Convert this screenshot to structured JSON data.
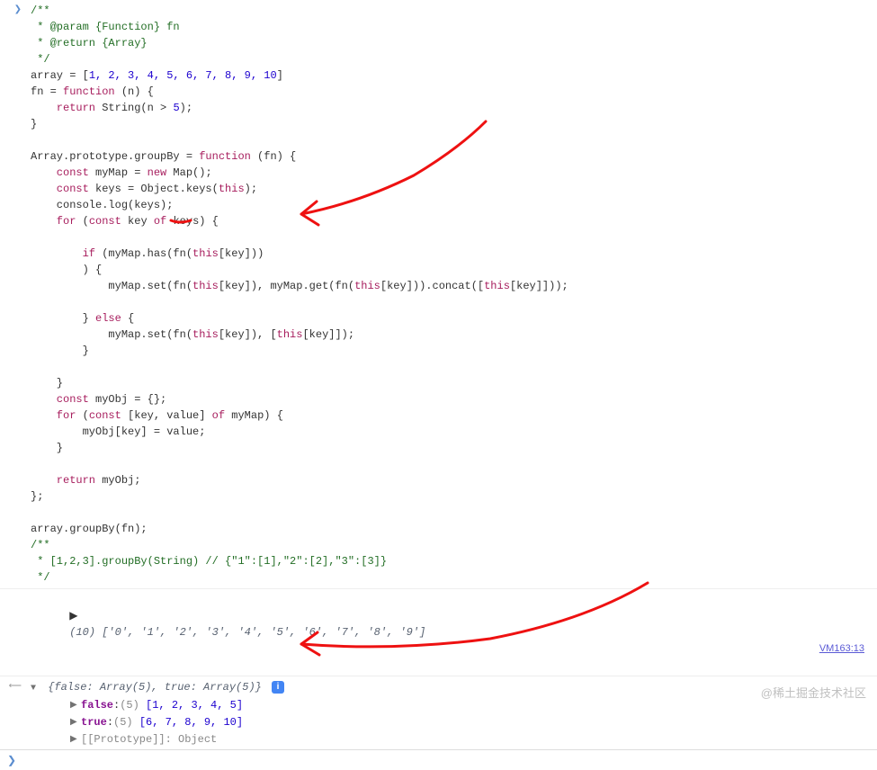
{
  "code": {
    "c1": "/**",
    "c2": " * @param {Function} fn",
    "c3": " * @return {Array}",
    "c4": " */",
    "c5_pre": "array = [",
    "c5_nums": "1, 2, 3, 4, 5, 6, 7, 8, 9, 10",
    "c5_post": "]",
    "c6": "fn = ",
    "c6_fn": "function",
    "c6_post": " (n) {",
    "c7_ret": "    return",
    "c7_post": " String(n > ",
    "c7_num": "5",
    "c7_end": ");",
    "c8": "}",
    "blank": "",
    "c9": "Array.prototype.groupBy = ",
    "c9_fn": "function",
    "c9_post": " (fn) {",
    "c10_const": "    const",
    "c10_post": " myMap = ",
    "c10_new": "new",
    "c10_end": " Map();",
    "c11_const": "    const",
    "c11_post": " keys = Object.keys(",
    "c11_this": "this",
    "c11_end": ");",
    "c12": "    console.log(keys);",
    "c13_for": "    for",
    "c13_post": " (",
    "c13_const": "const",
    "c13_key": " key ",
    "c13_of": "of",
    "c13_end": " keys) {",
    "c14_if": "        if",
    "c14_post": " (myMap.has(fn(",
    "c14_this": "this",
    "c14_end": "[key]))",
    "c15": "        ) {",
    "c16_1": "            myMap.set(fn(",
    "c16_this1": "this",
    "c16_2": "[key]), myMap.get(fn(",
    "c16_this2": "this",
    "c16_3": "[key])).concat([",
    "c16_this3": "this",
    "c16_4": "[key]]));",
    "c17": "        } ",
    "c17_else": "else",
    "c17_post": " {",
    "c18_1": "            myMap.set(fn(",
    "c18_this1": "this",
    "c18_2": "[key]), [",
    "c18_this2": "this",
    "c18_3": "[key]]);",
    "c19": "        }",
    "c20": "    }",
    "c21_const": "    const",
    "c21_post": " myObj = {};",
    "c22_for": "    for",
    "c22_post": " (",
    "c22_const": "const",
    "c22_mid": " [key, value] ",
    "c22_of": "of",
    "c22_end": " myMap) {",
    "c23": "        myObj[key] = value;",
    "c24": "    }",
    "c25_ret": "    return",
    "c25_post": " myObj;",
    "c26": "};",
    "c27": "array.groupBy(fn);",
    "c28": "/**",
    "c29": " * [1,2,3].groupBy(String) // {\"1\":[1],\"2\":[2],\"3\":[3]}",
    "c30": " */"
  },
  "output": {
    "log_preview": "(10) ['0', '1', '2', '3', '4', '5', '6', '7', '8', '9']",
    "source_link": "VM163:13",
    "result_header": "{false: Array(5), true: Array(5)}",
    "false_key": "false",
    "false_len": "(5)",
    "false_arr": "[1, 2, 3, 4, 5]",
    "true_key": "true",
    "true_len": "(5)",
    "true_arr": "[6, 7, 8, 9, 10]",
    "proto_key": "[[Prototype]]",
    "proto_val": ": Object"
  },
  "info_label": "i",
  "watermark": "@稀土掘金技术社区",
  "prompt_arrow": "❯"
}
